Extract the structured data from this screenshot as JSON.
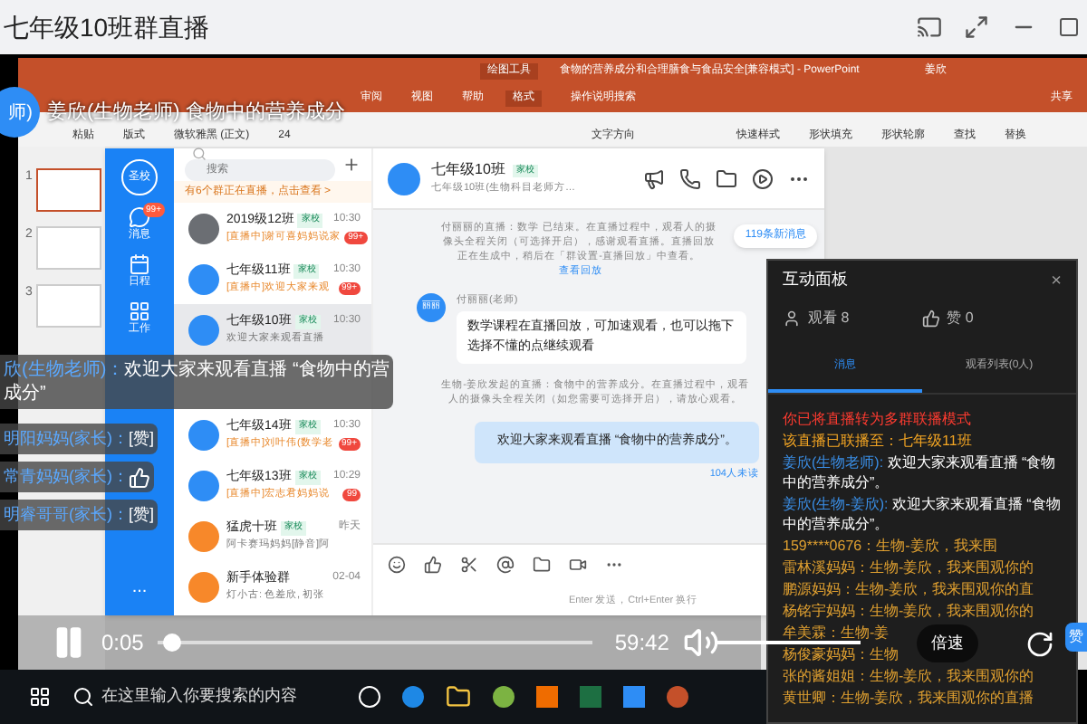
{
  "window": {
    "title": "七年级10班群直播"
  },
  "stream": {
    "avatar": "师)",
    "title": "姜欣(生物老师) 食物中的营养成分"
  },
  "ppt": {
    "context_tab": "绘图工具",
    "doc_title": "食物的营养成分和合理膳食与食品安全[兼容模式] - PowerPoint",
    "user": "姜欣",
    "tabs": [
      {
        "label": "审阅",
        "selected": false
      },
      {
        "label": "视图",
        "selected": false
      },
      {
        "label": "帮助",
        "selected": false
      },
      {
        "label": "格式",
        "selected": true
      }
    ],
    "search": "操作说明搜索",
    "share": "共享",
    "ribbon": [
      "粘贴",
      "版式",
      "微软雅黑 (正文)",
      "24",
      "文字方向",
      "快速样式",
      "形状填充",
      "形状轮廓",
      "查找",
      "替换"
    ],
    "slides": [
      "1",
      "2",
      "3"
    ]
  },
  "im": {
    "school": "圣校",
    "nav": [
      {
        "label": "消息",
        "badge": "99+",
        "selected": true
      },
      {
        "label": "日程",
        "selected": false
      },
      {
        "label": "工作",
        "selected": false
      }
    ],
    "more": "...",
    "search_placeholder": "搜索",
    "live_banner": "有6个群正在直播，点击查看 >",
    "chats": [
      {
        "name": "2019级12班",
        "tag": "家校",
        "time": "10:30",
        "preview": "[直播中]谢可喜妈妈说家",
        "badge": "99+",
        "selected": false
      },
      {
        "name": "七年级11班",
        "tag": "家校",
        "time": "10:30",
        "preview": "[直播中]欢迎大家来观",
        "badge": "99+",
        "selected": false
      },
      {
        "name": "七年级10班",
        "tag": "家校",
        "time": "10:30",
        "preview": "欢迎大家来观看直播",
        "selected": true
      },
      {
        "kind": "covered"
      },
      {
        "name": "七年级14班",
        "tag": "家校",
        "time": "10:30",
        "preview": "[直播中]刘叶伟(数学老",
        "badge": "99+",
        "selected": false
      },
      {
        "name": "七年级13班",
        "tag": "家校",
        "time": "10:29",
        "preview": "[直播中]宏志君妈妈说",
        "badge": "99",
        "selected": false
      },
      {
        "name": "猛虎十班",
        "tag": "家校",
        "time": "昨天",
        "preview": "阿卡赛玛妈妈[静音]阿",
        "selected": false
      },
      {
        "name": "新手体验群",
        "time": "02-04",
        "preview": "灯小古: 色差欣, 初张",
        "selected": false
      }
    ],
    "header": {
      "name": "七年级10班",
      "tag": "家校",
      "subtitle": "七年级10班(生物科目老师方…"
    },
    "new_messages": "119条新消息",
    "messages": [
      {
        "kind": "system",
        "text": "付丽丽的直播：数学 已结束。在直播过程中，观看人的摄像头全程关闭（可选择开启），感谢观看直播。直播回放正在生成中，稍后在「群设置-直播回放」中查看。",
        "link": "查看回放"
      },
      {
        "kind": "incoming",
        "sender": "付丽丽(老师)",
        "avatar": "丽丽",
        "text": "数学课程在直播回放，可加速观看，也可以拖下选择不懂的点继续观看"
      },
      {
        "kind": "system",
        "text": "生物-姜欣发起的直播：食物中的营养成分。在直播过程中，观看人的摄像头全程关闭（如您需要可选择开启），请放心观看。"
      },
      {
        "kind": "outgoing",
        "text": "欢迎大家来观看直播 “食物中的营养成分”。",
        "unread": "104人未读"
      }
    ],
    "input_hint": "Enter 发送，Ctrl+Enter 换行"
  },
  "danmaku": [
    {
      "name": "欣(生物老师)：",
      "kind": "text",
      "text": "欢迎大家来观看直播 “食物中的营",
      "rest": "成分”"
    },
    {
      "name": "明阳妈妈(家长)：",
      "kind": "text",
      "text": "[赞]"
    },
    {
      "name": "常青妈妈(家长)：",
      "kind": "like"
    },
    {
      "name": "明睿哥哥(家长)：",
      "kind": "text",
      "text": "[赞]"
    }
  ],
  "panel": {
    "title": "互动面板",
    "close": "×",
    "viewers": "观看 8",
    "likes": "赞 0",
    "tabs": [
      {
        "label": "消息",
        "selected": true
      },
      {
        "label": "观看列表(0人)",
        "selected": false
      }
    ],
    "messages": [
      {
        "kind": "alert",
        "text": "你已将直播转为多群联播模式"
      },
      {
        "kind": "notice",
        "text": "该直播已联播至：七年级11班"
      },
      {
        "kind": "teacher",
        "name": "姜欣(生物老师):",
        "text": "欢迎大家来观看直播 “食物中的营养成分”。"
      },
      {
        "kind": "teacher",
        "name": "姜欣(生物-姜欣):",
        "text": "欢迎大家来观看直播 “食物中的营养成分”。"
      },
      {
        "kind": "viewer",
        "text": "159****0676：生物-姜欣，我来围"
      },
      {
        "kind": "viewer",
        "text": "雷林溪妈妈：生物-姜欣，我来围观你的"
      },
      {
        "kind": "viewer",
        "text": "鹏源妈妈：生物-姜欣，我来围观你的直"
      },
      {
        "kind": "viewer",
        "text": "杨铭宇妈妈：生物-姜欣，我来围观你的"
      },
      {
        "kind": "viewer",
        "text": "牟美霖：生物-姜"
      },
      {
        "kind": "viewer",
        "text": "杨俊豪妈妈：生物"
      },
      {
        "kind": "viewer",
        "text": "张的酱姐姐：生物-姜欣，我来围观你的"
      },
      {
        "kind": "viewer",
        "text": "黄世卿：生物-姜欣，我来围观你的直播"
      }
    ],
    "like_badge": "赞"
  },
  "player": {
    "elapsed": "0:05",
    "duration": "59:42",
    "progress": {
      "level": 0.01
    },
    "volume": {
      "level": 1
    },
    "speed": "倍速"
  },
  "taskbar": {
    "search_placeholder": "在这里输入你要搜索的内容"
  }
}
